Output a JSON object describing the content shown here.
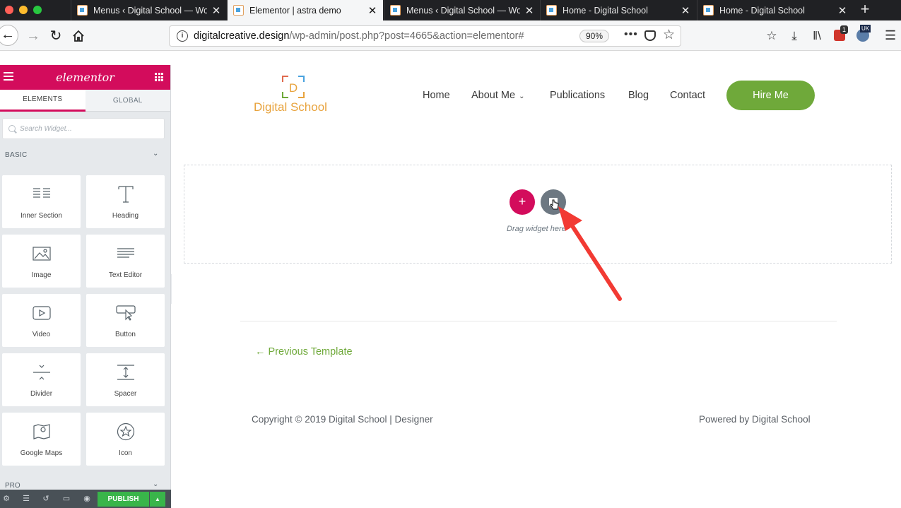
{
  "browser": {
    "tabs": [
      {
        "title": "Menus ‹ Digital School — Wor",
        "active": false
      },
      {
        "title": "Elementor | astra demo",
        "active": true
      },
      {
        "title": "Menus ‹ Digital School — Wor",
        "active": false
      },
      {
        "title": "Home - Digital School",
        "active": false
      },
      {
        "title": "Home - Digital School",
        "active": false
      }
    ],
    "tab_close": "✕",
    "new_tab": "+",
    "url_host": "digitalcreative.design",
    "url_path": "/wp-admin/post.php?post=4665&action=elementor#",
    "zoom": "90%",
    "badge_count": "1",
    "locale_badge": "UK"
  },
  "panel": {
    "brand": "elementor",
    "tabs": {
      "elements": "ELEMENTS",
      "global": "GLOBAL"
    },
    "search_placeholder": "Search Widget...",
    "section_basic": "BASIC",
    "section_pro": "PRO",
    "widgets": [
      {
        "label": "Inner Section",
        "icon": "inner-section-icon"
      },
      {
        "label": "Heading",
        "icon": "heading-icon"
      },
      {
        "label": "Image",
        "icon": "image-icon"
      },
      {
        "label": "Text Editor",
        "icon": "text-editor-icon"
      },
      {
        "label": "Video",
        "icon": "video-icon"
      },
      {
        "label": "Button",
        "icon": "button-icon"
      },
      {
        "label": "Divider",
        "icon": "divider-icon"
      },
      {
        "label": "Spacer",
        "icon": "spacer-icon"
      },
      {
        "label": "Google Maps",
        "icon": "google-maps-icon"
      },
      {
        "label": "Icon",
        "icon": "star-icon"
      }
    ],
    "publish_label": "PUBLISH"
  },
  "site": {
    "logo_letter": "D",
    "logo_text": "Digital School",
    "menu": {
      "home": "Home",
      "about": "About Me",
      "publications": "Publications",
      "blog": "Blog",
      "contact": "Contact"
    },
    "hire_button": "Hire Me",
    "add_symbol": "+",
    "drag_text": "Drag widget here",
    "prev_template": "← Previous Template",
    "copyright": "Copyright © 2019 Digital School | Designer",
    "powered": "Powered by Digital School"
  },
  "colors": {
    "elementor_brand": "#d30c5c",
    "hire_green": "#6fa93a",
    "publish_green": "#39b54a",
    "annotation_arrow": "#f23a33"
  }
}
